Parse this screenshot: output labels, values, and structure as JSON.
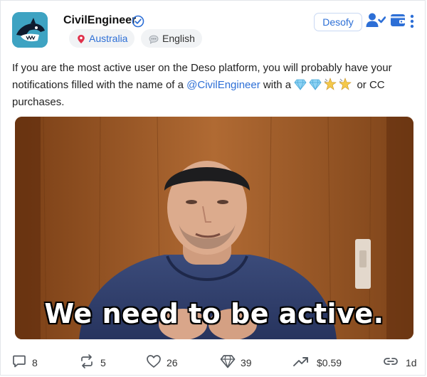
{
  "post": {
    "username": "CivilEngineer",
    "location": "Australia",
    "language": "English",
    "text_before": "If you are the most active user on the Deso platform, you will probably have your notifications filled with the name of a ",
    "mention": "@CivilEngineer",
    "text_middle": " with a ",
    "text_after": " or CC purchases.",
    "emojis": [
      "diamond-icon",
      "diamond-icon",
      "shooting-star-icon",
      "shooting-star-icon"
    ],
    "media_caption": "We need to be active."
  },
  "header": {
    "desofy_label": "Desofy"
  },
  "actions": {
    "comments": "8",
    "reposts": "5",
    "likes": "26",
    "diamonds": "39",
    "price": "$0.59",
    "age": "1d"
  },
  "colors": {
    "accent": "#2d6fd6",
    "pill_bg": "#f1f3f5"
  }
}
